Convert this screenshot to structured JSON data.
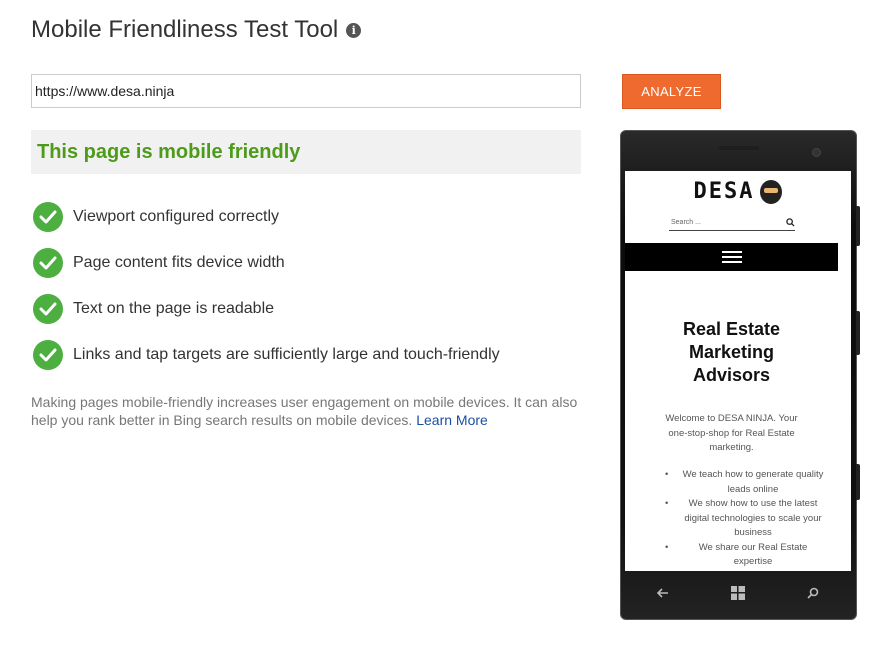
{
  "header": {
    "title": "Mobile Friendliness Test Tool",
    "info_icon": "info-icon"
  },
  "url_input": {
    "value": "https://www.desa.ninja"
  },
  "analyze_button": {
    "label": "ANALYZE",
    "color": "#ee6a2f"
  },
  "result": {
    "text": "This page is mobile friendly",
    "color": "#4d9b19"
  },
  "checks": [
    {
      "label": "Viewport configured correctly",
      "icon": "check-icon"
    },
    {
      "label": "Page content fits device width",
      "icon": "check-icon"
    },
    {
      "label": "Text on the page is readable",
      "icon": "check-icon"
    },
    {
      "label": "Links and tap targets are sufficiently large and touch-friendly",
      "icon": "check-icon"
    }
  ],
  "note": {
    "text": "Making pages mobile-friendly increases user engagement on mobile devices. It can also help you rank better in Bing search results on mobile devices.",
    "link": "Learn More"
  },
  "phone_preview": {
    "logo": "DESA",
    "search_placeholder": "Search ...",
    "hero_title": [
      "Real Estate",
      "Marketing",
      "Advisors"
    ],
    "welcome": "Welcome to DESA NINJA. Your one-stop-shop for Real Estate marketing.",
    "bullets": [
      "We teach how to generate quality leads online",
      "We show how to use the latest digital technologies to scale your business",
      "We share our Real Estate expertise"
    ],
    "nav_icons": [
      "back-arrow-icon",
      "windows-icon",
      "search-icon"
    ]
  }
}
